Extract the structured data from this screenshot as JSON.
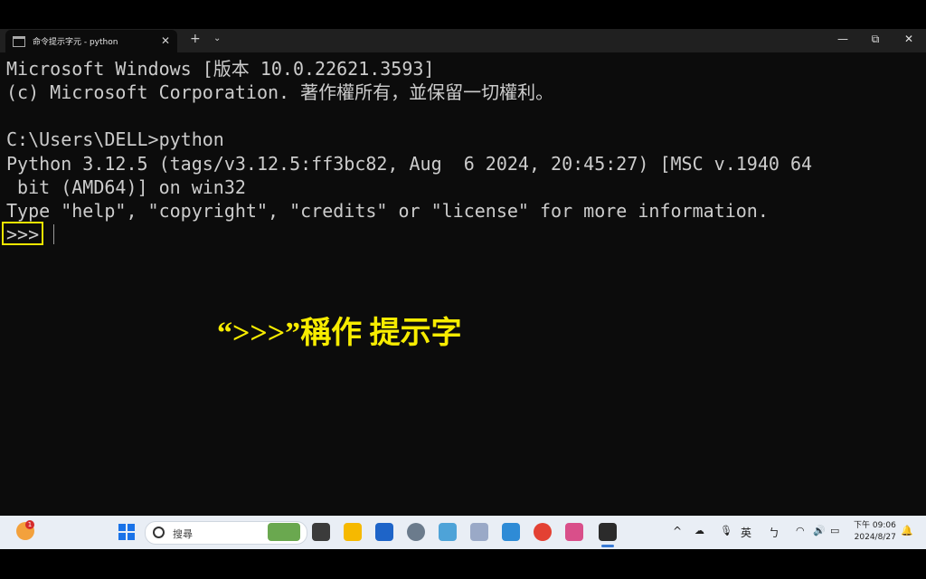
{
  "window": {
    "tab_title": "命令提示字元 - python",
    "tab_close": "✕",
    "new_tab": "+",
    "tab_dropdown": "⌄",
    "minimize": "—",
    "maximize": "⧉",
    "close": "✕"
  },
  "terminal": {
    "lines": [
      "Microsoft Windows [版本 10.0.22621.3593]",
      "(c) Microsoft Corporation. 著作權所有，並保留一切權利。",
      "",
      "C:\\Users\\DELL>python",
      "Python 3.12.5 (tags/v3.12.5:ff3bc82, Aug  6 2024, 20:45:27) [MSC v.1940 64",
      " bit (AMD64)] on win32",
      "Type \"help\", \"copyright\", \"credits\" or \"license\" for more information.",
      ">>>"
    ],
    "annotation": "“>>>”稱作 提示字",
    "highlight_color": "#f2e600"
  },
  "taskbar": {
    "widget_badge": "1",
    "search_placeholder": "搜尋",
    "tray": {
      "chevron": "^",
      "ime": "英",
      "ime_mode": "ㄅ"
    },
    "clock_time": "下午 09:06",
    "clock_date": "2024/8/27"
  }
}
